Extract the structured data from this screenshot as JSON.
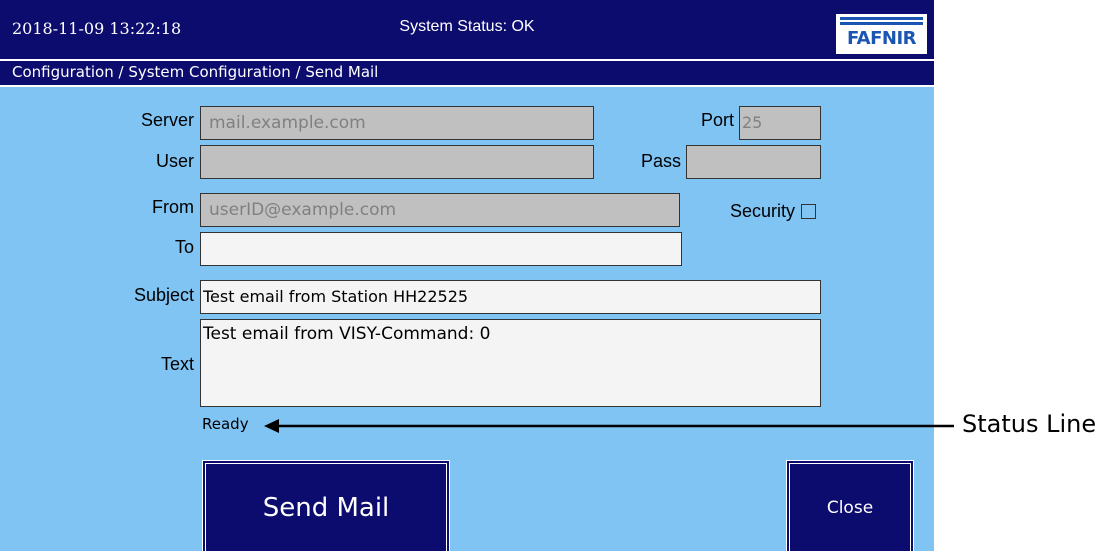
{
  "header": {
    "datetime": "2018-11-09  13:22:18",
    "system_status": "System Status: OK",
    "logo_text": "FAFNIR"
  },
  "breadcrumb": "Configuration / System Configuration / Send Mail",
  "form": {
    "server": {
      "label": "Server",
      "value": "mail.example.com"
    },
    "port": {
      "label": "Port",
      "value": "25"
    },
    "user": {
      "label": "User",
      "value": ""
    },
    "pass": {
      "label": "Pass",
      "value": ""
    },
    "from": {
      "label": "From",
      "value": "userID@example.com"
    },
    "security": {
      "label": "Security",
      "checked": false
    },
    "to": {
      "label": "To",
      "value": ""
    },
    "subject": {
      "label": "Subject",
      "value": "Test email from Station HH22525"
    },
    "text": {
      "label": "Text",
      "value": "Test email from VISY-Command: 0"
    }
  },
  "status_line": "Ready",
  "buttons": {
    "send_mail": "Send Mail",
    "close": "Close"
  },
  "annotation": {
    "label": "Status Line"
  },
  "colors": {
    "background": "#80c4f4",
    "bar": "#0c0c6e",
    "disabled_field": "#c0c0c0",
    "enabled_field": "#f4f4f4",
    "logo": "#1b56b3"
  }
}
